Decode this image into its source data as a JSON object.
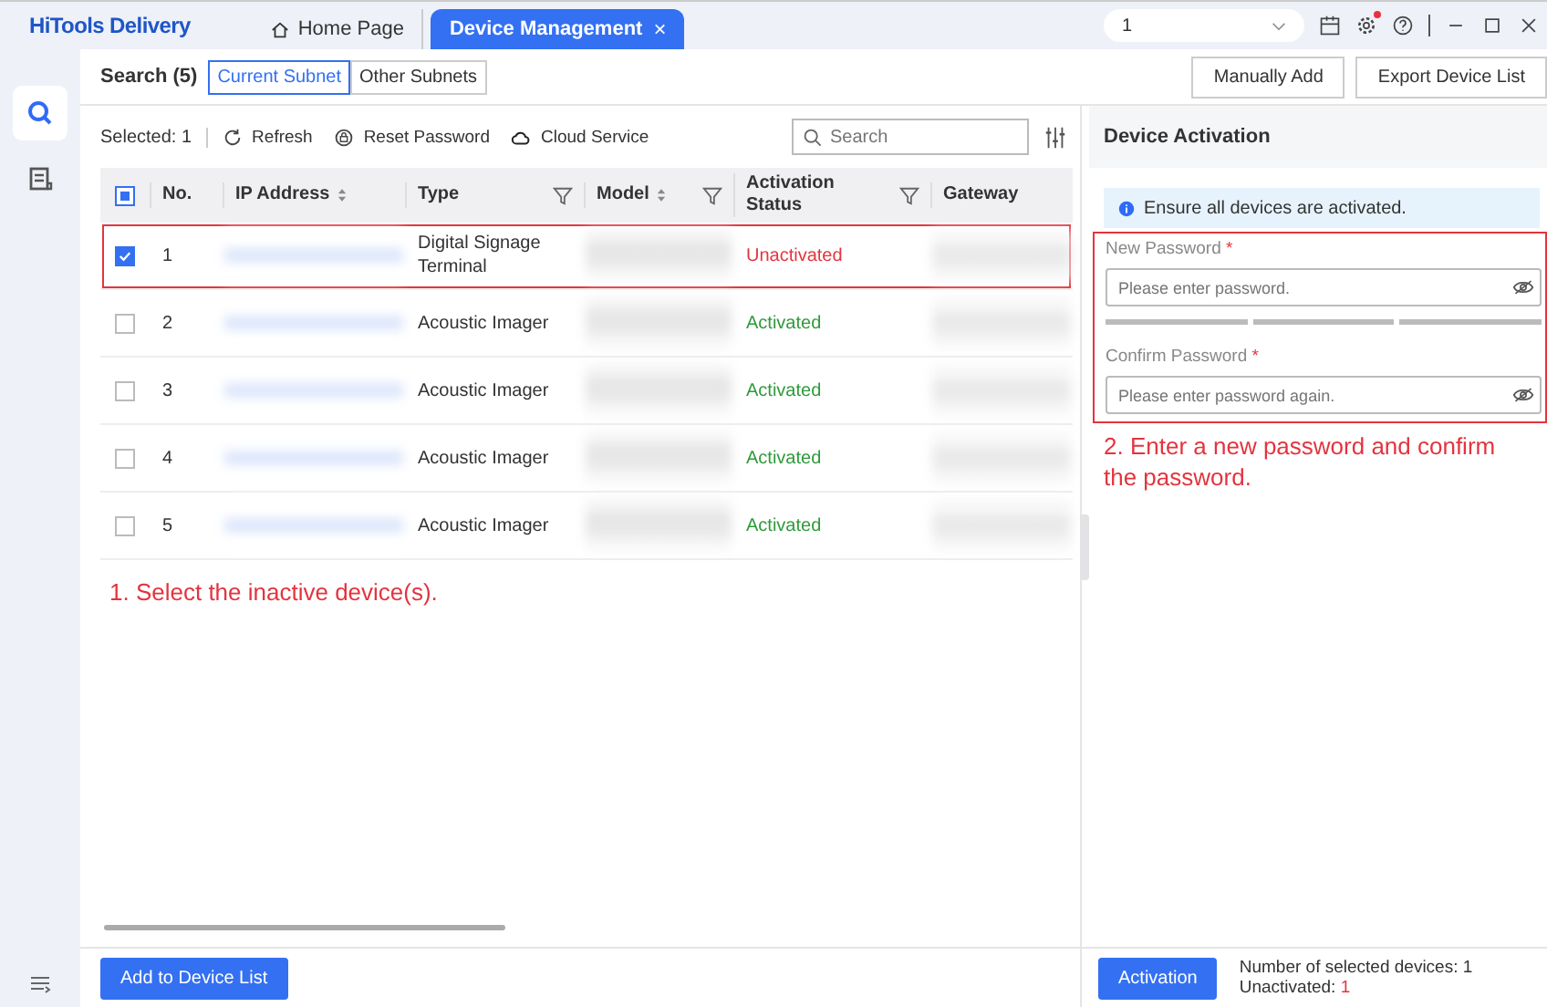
{
  "app": {
    "logo": "HiTools Delivery"
  },
  "tabs": [
    {
      "label": "Home Page",
      "selected": false,
      "closable": false
    },
    {
      "label": "Device Management",
      "selected": true,
      "closable": true
    }
  ],
  "title_bar": {
    "dropdown_value": "1",
    "close_tab_glyph": "×"
  },
  "notification": {
    "settings_dot": true
  },
  "search_bar": {
    "title": "Search (5)",
    "subnet_tabs": [
      {
        "label": "Current Subnet",
        "selected": true
      },
      {
        "label": "Other Subnets",
        "selected": false
      }
    ],
    "buttons": [
      "Manually Add",
      "Export Device List"
    ]
  },
  "toolbar": {
    "selected_count": "Selected: 1",
    "actions": [
      {
        "kind": "refresh",
        "label": "Refresh"
      },
      {
        "kind": "reset",
        "label": "Reset Password"
      },
      {
        "kind": "cloud",
        "label": "Cloud Service"
      }
    ],
    "search_placeholder": "Search"
  },
  "table": {
    "columns": [
      {
        "label": "No.",
        "sortable": false,
        "filter": false
      },
      {
        "label": "IP Address",
        "sortable": true,
        "filter": false
      },
      {
        "label": "Type",
        "sortable": false,
        "filter": true
      },
      {
        "label": "Model",
        "sortable": true,
        "filter": true
      },
      {
        "label": "Activation Status",
        "sortable": false,
        "filter": true
      },
      {
        "label": "Gateway",
        "sortable": false,
        "filter": false
      }
    ],
    "header_checkbox_partial": true,
    "rows": [
      {
        "no": "1",
        "type": "Digital Signage Terminal",
        "status": "Unactivated",
        "activated": false,
        "selected": true,
        "annotated": true
      },
      {
        "no": "2",
        "type": "Acoustic Imager",
        "status": "Activated",
        "activated": true,
        "selected": false,
        "annotated": false
      },
      {
        "no": "3",
        "type": "Acoustic Imager",
        "status": "Activated",
        "activated": true,
        "selected": false,
        "annotated": false
      },
      {
        "no": "4",
        "type": "Acoustic Imager",
        "status": "Activated",
        "activated": true,
        "selected": false,
        "annotated": false
      },
      {
        "no": "5",
        "type": "Acoustic Imager",
        "status": "Activated",
        "activated": true,
        "selected": false,
        "annotated": false
      }
    ]
  },
  "left_note": "1. Select the inactive device(s).",
  "activation_panel": {
    "title": "Device Activation",
    "info": "Ensure all devices are activated.",
    "fields": [
      {
        "label": "New Password",
        "required_mark": "*",
        "placeholder": "Please enter password.",
        "kind": "new_password"
      },
      {
        "label": "Confirm Password",
        "required_mark": "*",
        "placeholder": "Please enter password again.",
        "kind": "confirm_password"
      }
    ],
    "note": "2. Enter a new password and confirm the password."
  },
  "footer": {
    "add_button": "Add to Device List",
    "activate_button": "Activation",
    "selected_devices": "Number of selected devices: 1",
    "unactivated_label": "Unactivated:",
    "unactivated_count": "1"
  }
}
